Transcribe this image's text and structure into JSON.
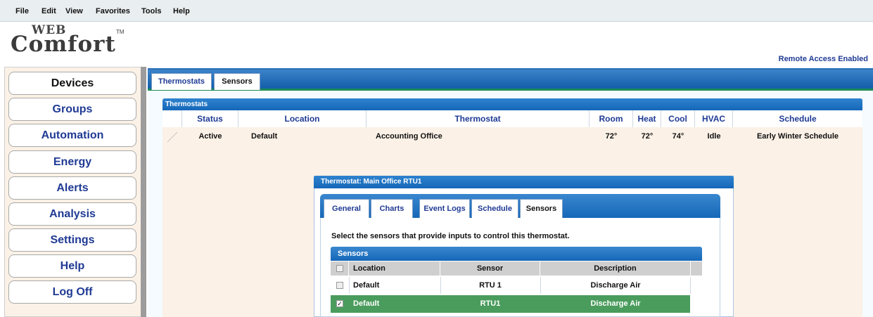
{
  "menu": [
    "File",
    "Edit",
    "View",
    "Favorites",
    "Tools",
    "Help"
  ],
  "logo": {
    "web": "WEB",
    "comfort": "Comfort",
    "tm": "TM"
  },
  "remote_access": "Remote Access Enabled",
  "nav": [
    "Devices",
    "Groups",
    "Automation",
    "Energy",
    "Alerts",
    "Analysis",
    "Settings",
    "Help",
    "Log Off"
  ],
  "tabs": {
    "thermostats": "Thermostats",
    "sensors": "Sensors"
  },
  "thermo_panel": {
    "title": "Thermostats",
    "columns": [
      "Status",
      "Location",
      "Thermostat",
      "Room",
      "Heat",
      "Cool",
      "HVAC",
      "Schedule"
    ],
    "row": [
      "Active",
      "Default",
      "Accounting Office",
      "72°",
      "72°",
      "74°",
      "Idle",
      "Early Winter Schedule"
    ]
  },
  "dialog": {
    "title": "Thermostat: Main Office RTU1",
    "tabs": [
      "General",
      "Charts",
      "Event Logs",
      "Schedule",
      "Sensors"
    ],
    "instruction": "Select the sensors that provide inputs to control this thermostat.",
    "sensors_title": "Sensors",
    "columns": [
      "Location",
      "Sensor",
      "Description"
    ],
    "rows": [
      {
        "location": "Default",
        "sensor": "RTU 1",
        "description": "Discharge Air",
        "checked": false
      },
      {
        "location": "Default",
        "sensor": "RTU1",
        "description": "Discharge Air",
        "checked": true
      }
    ]
  },
  "colors": {
    "accent": "#1f3a94",
    "tab_blue": "#1567b8",
    "selected_row": "#4a9c5d",
    "panel_bg": "#fbf1e6"
  }
}
